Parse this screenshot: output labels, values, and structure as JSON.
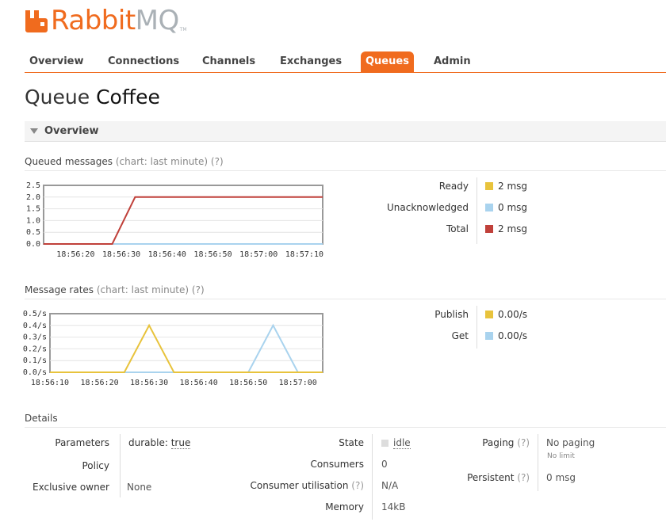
{
  "brand": {
    "word_rabbit": "Rabbit",
    "word_mq": "MQ",
    "tm": "TM",
    "color": "#f06b1e"
  },
  "nav": {
    "tabs": [
      {
        "label": "Overview",
        "active": false
      },
      {
        "label": "Connections",
        "active": false
      },
      {
        "label": "Channels",
        "active": false
      },
      {
        "label": "Exchanges",
        "active": false
      },
      {
        "label": "Queues",
        "active": true
      },
      {
        "label": "Admin",
        "active": false
      }
    ]
  },
  "page": {
    "prefix": "Queue",
    "queue_name": "Coffee"
  },
  "overview_section": {
    "label": "Overview"
  },
  "queued_messages": {
    "heading": "Queued messages",
    "hint": "(chart: last minute)",
    "help": "(?)",
    "legend": [
      {
        "label": "Ready",
        "value": "2 msg",
        "color": "#e8c33c"
      },
      {
        "label": "Unacknowledged",
        "value": "0 msg",
        "color": "#a9d3ee"
      },
      {
        "label": "Total",
        "value": "2 msg",
        "color": "#c0403a"
      }
    ]
  },
  "message_rates": {
    "heading": "Message rates",
    "hint": "(chart: last minute)",
    "help": "(?)",
    "legend": [
      {
        "label": "Publish",
        "value": "0.00/s",
        "color": "#e8c33c"
      },
      {
        "label": "Get",
        "value": "0.00/s",
        "color": "#a9d3ee"
      }
    ]
  },
  "chart_data": [
    {
      "type": "line",
      "y_tick_labels": [
        "2.5",
        "2.0",
        "1.5",
        "1.0",
        "0.5",
        "0.0"
      ],
      "ylim": [
        0,
        2.5
      ],
      "x_tick_labels": [
        "18:56:20",
        "18:56:30",
        "18:56:40",
        "18:56:50",
        "18:57:00",
        "18:57:10"
      ],
      "xlim": [
        "18:56:13",
        "18:57:14"
      ],
      "grid": true,
      "series": [
        {
          "name": "Total",
          "color": "#c0403a",
          "x": [
            "18:56:13",
            "18:56:28",
            "18:56:33",
            "18:57:14"
          ],
          "y": [
            0,
            0,
            2,
            2
          ]
        },
        {
          "name": "Unacknowledged",
          "color": "#a9d3ee",
          "x": [
            "18:56:13",
            "18:57:14"
          ],
          "y": [
            0,
            0
          ]
        }
      ]
    },
    {
      "type": "line",
      "y_tick_labels": [
        "0.5/s",
        "0.4/s",
        "0.3/s",
        "0.2/s",
        "0.1/s",
        "0.0/s"
      ],
      "ylim": [
        0,
        0.5
      ],
      "x_tick_labels": [
        "18:56:10",
        "18:56:20",
        "18:56:30",
        "18:56:40",
        "18:56:50",
        "18:57:00"
      ],
      "xlim": [
        "18:56:10",
        "18:57:05"
      ],
      "grid": true,
      "series": [
        {
          "name": "Publish",
          "color": "#e8c33c",
          "x": [
            "18:56:10",
            "18:56:25",
            "18:56:30",
            "18:56:35",
            "18:56:50",
            "18:56:55",
            "18:57:00",
            "18:57:05"
          ],
          "y": [
            0,
            0,
            0.4,
            0,
            0,
            0,
            0,
            0
          ]
        },
        {
          "name": "Get",
          "color": "#a9d3ee",
          "x": [
            "18:56:10",
            "18:56:50",
            "18:56:55",
            "18:57:00",
            "18:57:05"
          ],
          "y": [
            0,
            0,
            0.4,
            0,
            0
          ]
        }
      ]
    }
  ],
  "details": {
    "heading": "Details",
    "parameters_label": "Parameters",
    "parameters_key": "durable:",
    "parameters_val": "true",
    "policy_label": "Policy",
    "policy_val": "",
    "exclusive_owner_label": "Exclusive owner",
    "exclusive_owner_val": "None",
    "state_label": "State",
    "state_val": "idle",
    "consumers_label": "Consumers",
    "consumers_val": "0",
    "consumer_util_label": "Consumer utilisation",
    "consumer_util_help": "(?)",
    "consumer_util_val": "N/A",
    "memory_label": "Memory",
    "memory_val": "14kB",
    "paging_label": "Paging",
    "paging_help": "(?)",
    "paging_val": "No paging",
    "paging_sub": "No limit",
    "persistent_label": "Persistent",
    "persistent_help": "(?)",
    "persistent_val": "0 msg"
  }
}
